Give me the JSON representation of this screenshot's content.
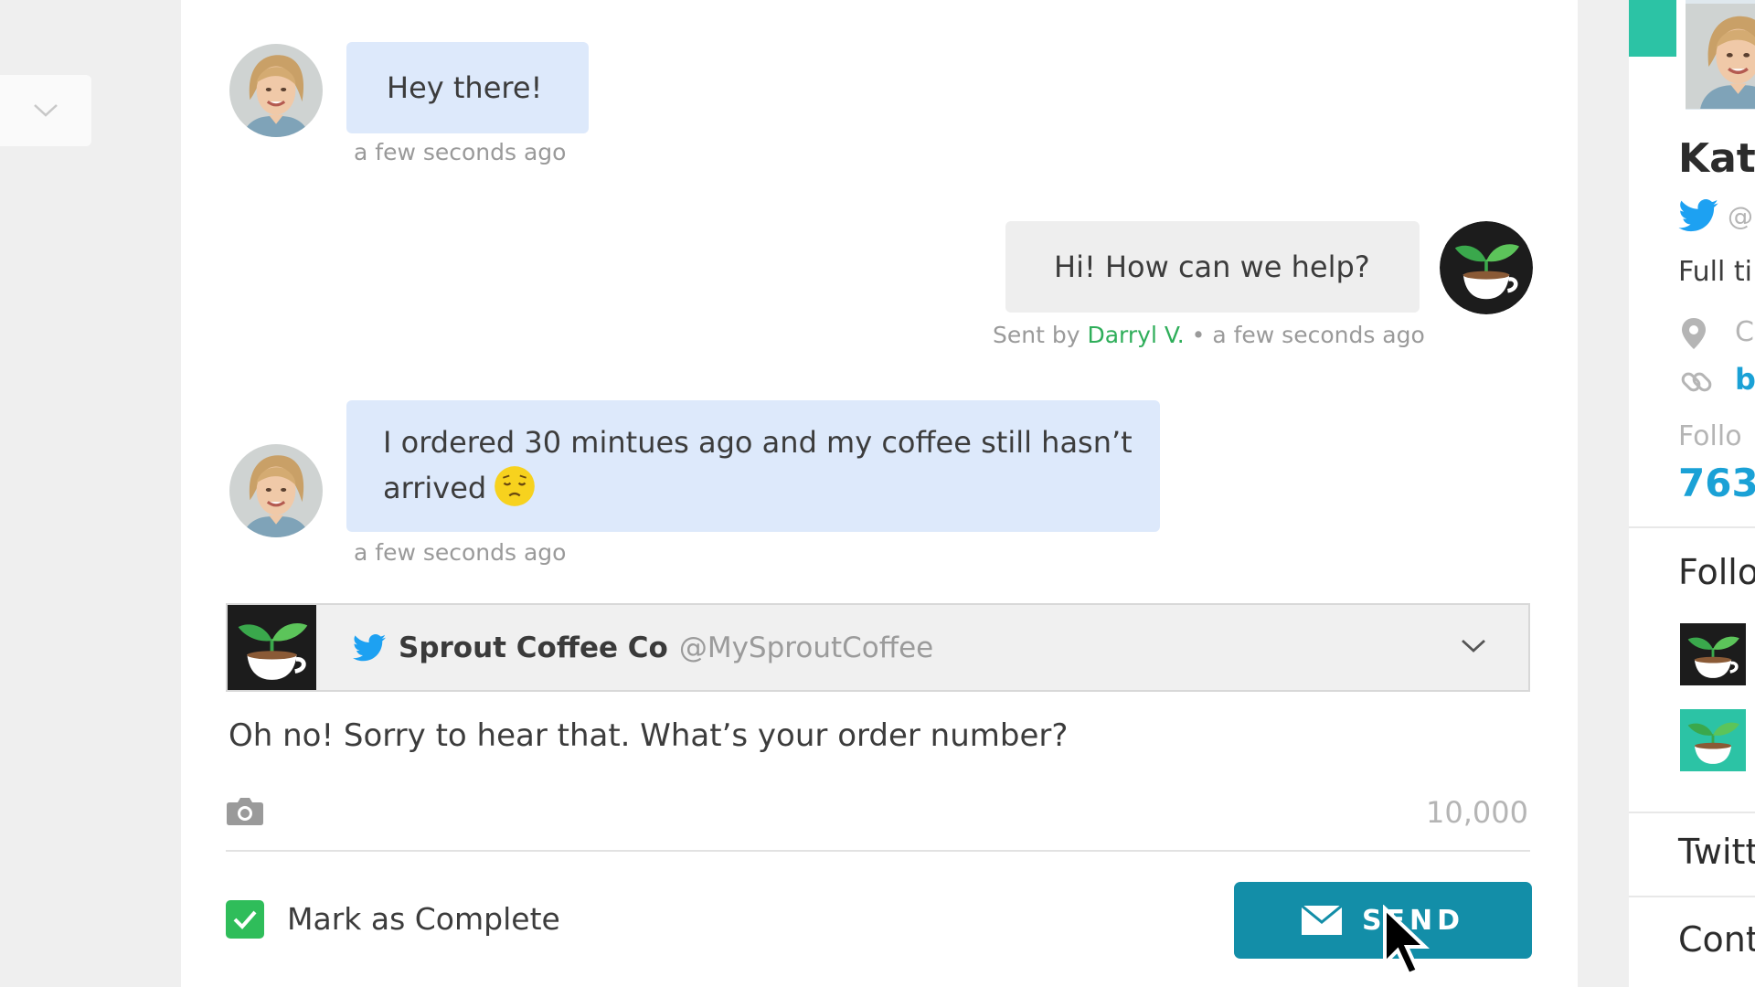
{
  "messages": [
    {
      "direction": "incoming",
      "text": "Hey there!",
      "timestamp": "a few seconds ago"
    },
    {
      "direction": "outgoing",
      "text": "Hi! How can we help?",
      "sent_by_prefix": "Sent by",
      "agent": "Darryl V.",
      "separator": "•",
      "timestamp": "a few seconds ago"
    },
    {
      "direction": "incoming",
      "text_line1": "I ordered 30 mintues ago and my coffee still hasn’t",
      "text_line2": "arrived",
      "emoji": "disappointed-face",
      "timestamp": "a few seconds ago"
    }
  ],
  "compose": {
    "profile_name": "Sprout Coffee Co",
    "profile_handle": "@MySproutCoffee",
    "network_icon": "twitter-icon",
    "draft": "Oh no! Sorry to hear that. What’s your order number?",
    "char_count": "10,000",
    "mark_complete_label": "Mark as Complete",
    "mark_complete_checked": true,
    "send_label": "SEND"
  },
  "right_panel": {
    "name": "Kati",
    "handle": "@",
    "bio": "Full ti",
    "location": "C",
    "link": "b",
    "followers_label": "Follo",
    "followers_count": "763",
    "followed_by_heading": "Follo",
    "twitter_heading": "Twitt",
    "contact_heading": "Cont"
  },
  "colors": {
    "incoming_bubble": "#dde9fb",
    "outgoing_bubble": "#eeeeee",
    "agent_name": "#2fae5a",
    "send_button": "#138ea8",
    "checkbox": "#2fbd5a",
    "accent_blue": "#1aa1d6",
    "teal": "#2cc3a5"
  }
}
